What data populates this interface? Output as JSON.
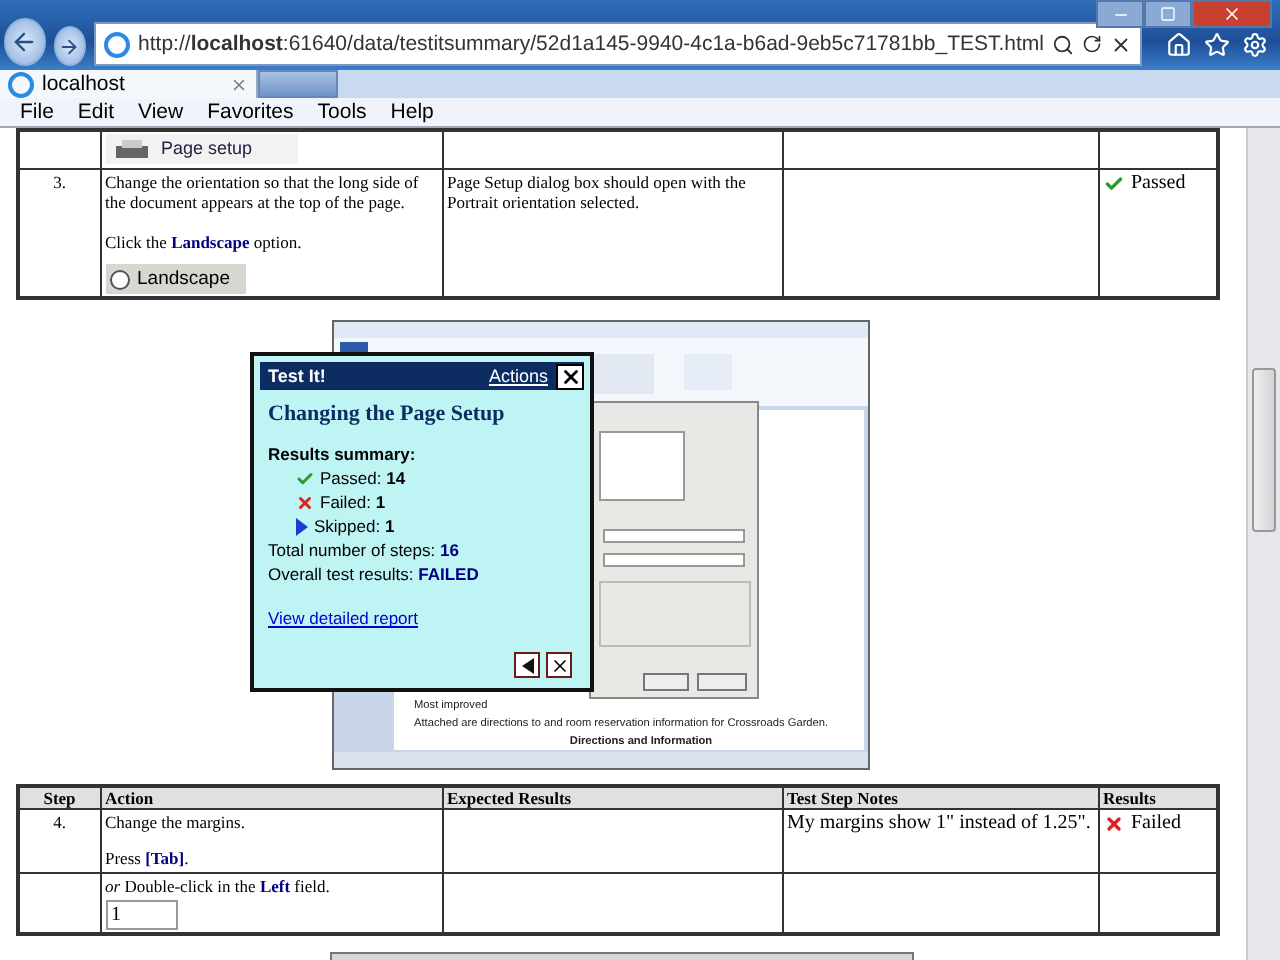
{
  "browser": {
    "address": "http://**localhost**:61640/data/testitsummary/52d1a145-9940-4c1a-b6ad-9eb5c71781bb_TEST.html",
    "tab_title": "localhost",
    "menu": [
      "File",
      "Edit",
      "View",
      "Favorites",
      "Tools",
      "Help"
    ]
  },
  "top_table": {
    "partial_row": {
      "image_caption": "Page setup"
    },
    "row": {
      "step": "3.",
      "action": [
        "Change the orientation so that the long side of the document appears at the top of the page.",
        "Click the **Landscape** option."
      ],
      "option_label": "Landscape",
      "option_checked": false,
      "expected": "Page Setup dialog box should open with the Portrait orientation selected.",
      "result": {
        "kind": "passed",
        "label": "Passed"
      }
    }
  },
  "figure": {
    "document_lines": [
      {
        "text": "Most improved",
        "kind": "plain"
      },
      {
        "text": "Attached are directions to and room reservation information for Crossroads Garden.",
        "kind": "plain"
      },
      {
        "text": "Directions and Information",
        "kind": "heading"
      }
    ],
    "dialog": {
      "title": "Test It!",
      "actions_link": "Actions",
      "heading": "Changing the Page Setup",
      "summary_label": "Results summary:",
      "counts": [
        {
          "kind": "passed",
          "label": "Passed:",
          "value": "14"
        },
        {
          "kind": "failed",
          "label": "Failed:",
          "value": "1"
        },
        {
          "kind": "skipped",
          "label": "Skipped:",
          "value": "1"
        }
      ],
      "total": "Total number of steps: **16**",
      "overall": "Overall test results: **FAILED**",
      "report_link": "View detailed report"
    }
  },
  "table": {
    "columns": [
      "Step",
      "Action",
      "Expected Results",
      "Test Step Notes",
      "Results"
    ],
    "rows": [
      {
        "step": "4.",
        "action": [
          "Change the margins.",
          "Press **[Tab]**."
        ],
        "notes": "My margins show 1\" instead of 1.25\".",
        "result": {
          "kind": "failed",
          "label": "Failed"
        }
      },
      {
        "action": [
          "*or* Double-click in the **Left** field."
        ],
        "field_value": "1"
      }
    ]
  }
}
